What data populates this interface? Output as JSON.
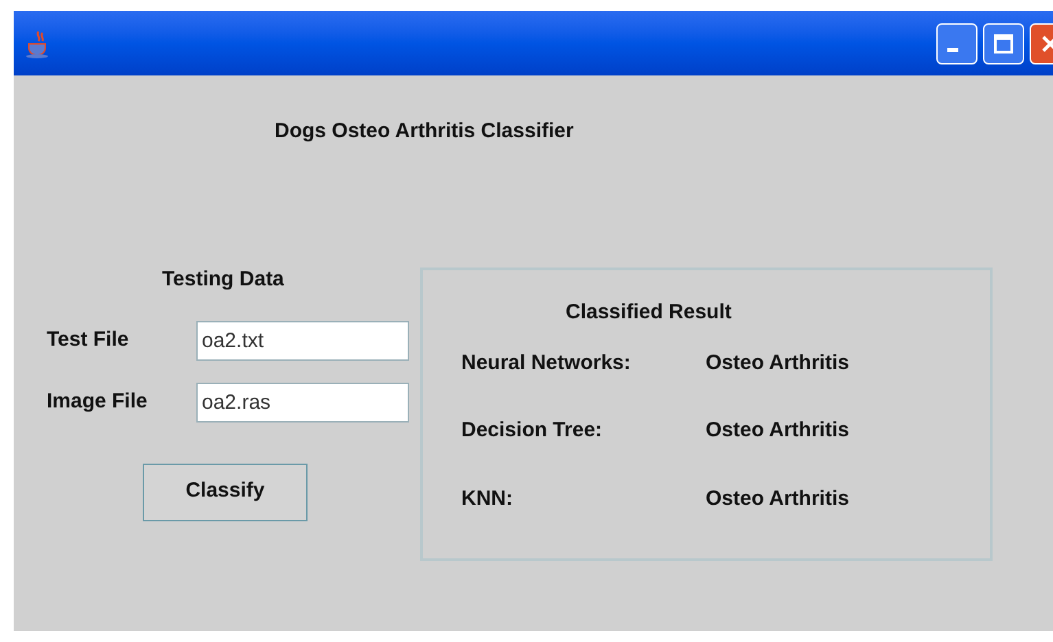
{
  "window": {
    "title_bar_buttons": [
      {
        "kind": "minimize"
      },
      {
        "kind": "maximize"
      },
      {
        "kind": "close"
      }
    ]
  },
  "heading": "Dogs Osteo Arthritis Classifier",
  "testing_data": {
    "title": "Testing Data",
    "fields": [
      {
        "label": "Test File",
        "value": "oa2.txt"
      },
      {
        "label": "Image File",
        "value": "oa2.ras"
      }
    ],
    "button": "Classify"
  },
  "classified_result": {
    "title": "Classified Result",
    "rows": [
      {
        "label": "Neural Networks:",
        "value": "Osteo Arthritis"
      },
      {
        "label": "Decision Tree:",
        "value": "Osteo Arthritis"
      },
      {
        "label": "KNN:",
        "value": "Osteo Arthritis"
      }
    ]
  }
}
